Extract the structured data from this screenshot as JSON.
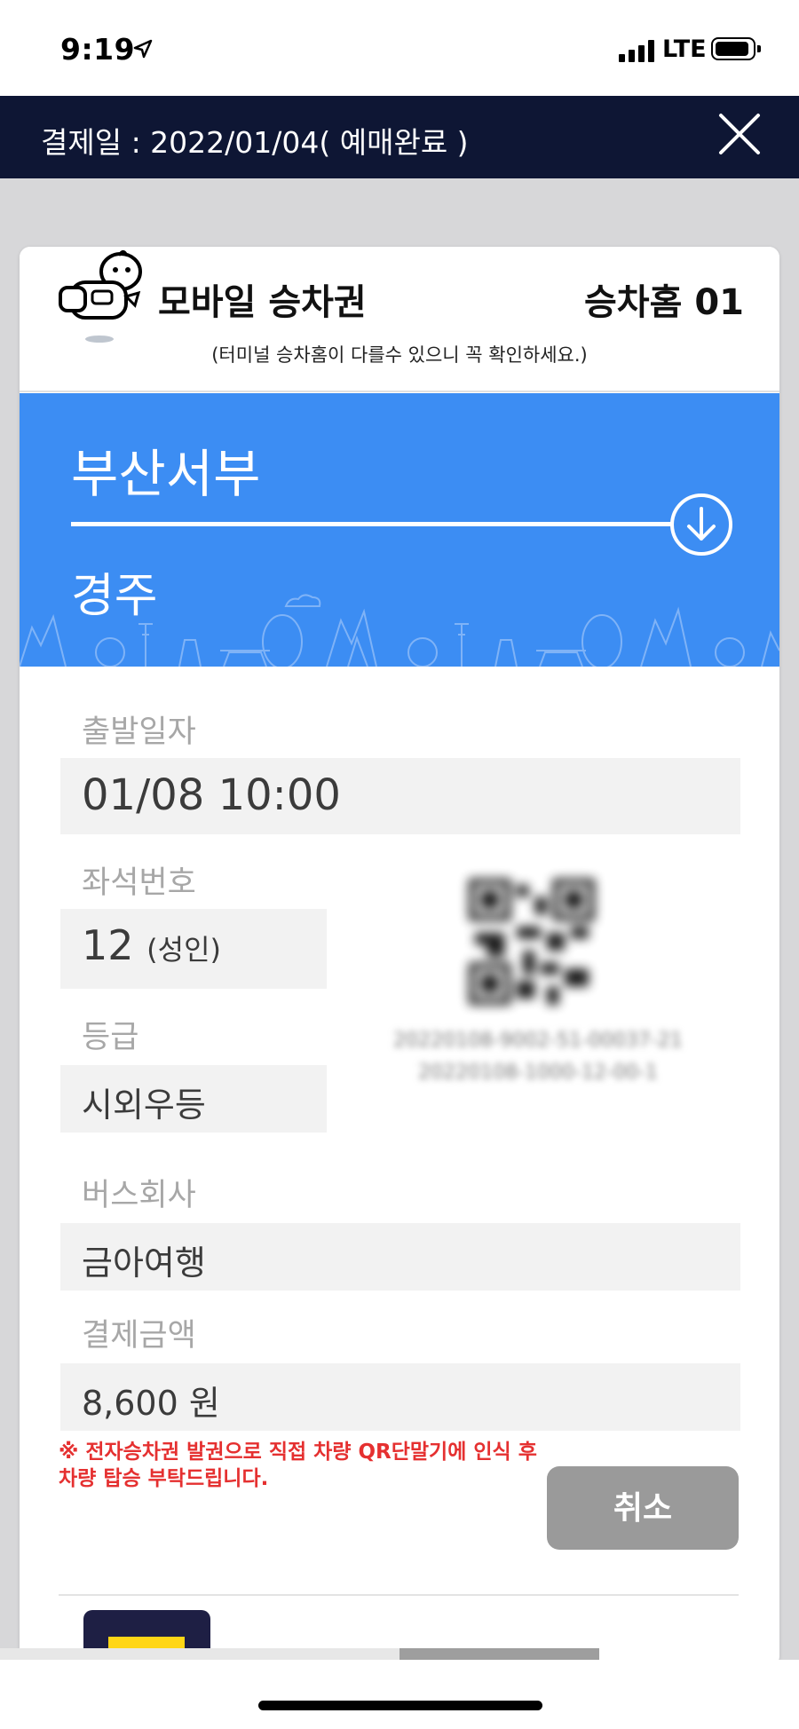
{
  "status_bar": {
    "time": "9:19",
    "location_icon": "location-arrow-icon",
    "network": "LTE",
    "signal_icon": "cellular-signal-icon",
    "battery_icon": "battery-icon"
  },
  "header": {
    "title": "결제일 : 2022/01/04( 예매완료 )",
    "close_icon": "close-icon",
    "background_color": "#0e1634"
  },
  "ticket": {
    "mascot_icon": "mascot-icon",
    "title": "모바일 승차권",
    "platform": "승차홈 01",
    "platform_notice": "(터미널 승차홈이 다를수 있으니 꼭 확인하세요.)",
    "route": {
      "origin": "부산서부",
      "destination": "경주",
      "direction_icon": "arrow-down-circle-icon",
      "color": "#3c8df3"
    },
    "fields": {
      "departure": {
        "label": "출발일자",
        "value": "01/08 10:00"
      },
      "seat": {
        "label": "좌석번호",
        "number": "12",
        "type": "(성인)"
      },
      "grade": {
        "label": "등급",
        "value": "시외우등"
      },
      "company": {
        "label": "버스회사",
        "value": "금아여행"
      },
      "fare": {
        "label": "결제금액",
        "value": "8,600 원"
      }
    },
    "qr": {
      "icon": "qr-code-icon",
      "code_line1": "20220108-9002-51-00037-21",
      "code_line2": "20220108-1000-12-00-1"
    },
    "notice": "※ 전자승차권 발권으로 직접 차량 QR단말기에 인식 후 차량 탑승 부탁드립니다.",
    "notice_color": "#e53030",
    "cancel_label": "취소"
  },
  "bottom": {
    "app_icon": "app-icon",
    "home_indicator": "home-indicator"
  }
}
